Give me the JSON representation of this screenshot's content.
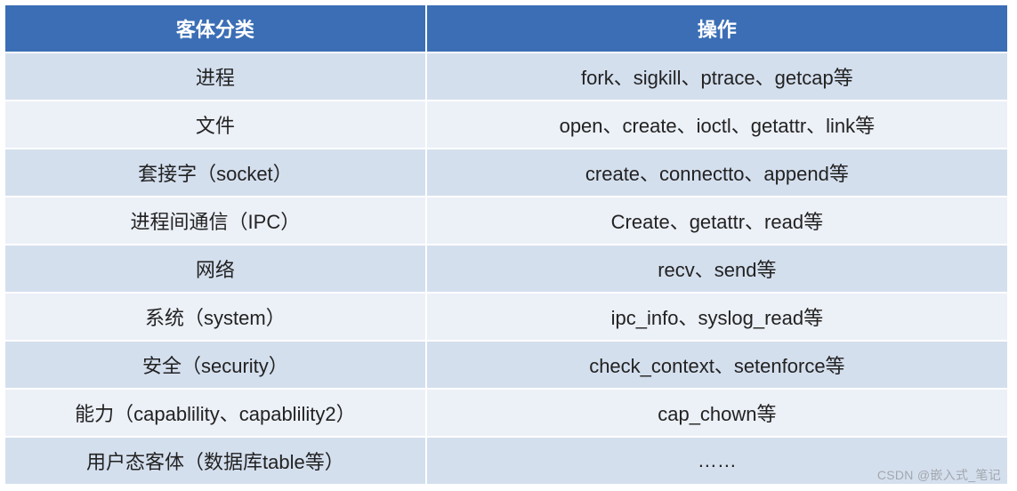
{
  "table": {
    "headers": [
      "客体分类",
      "操作"
    ],
    "rows": [
      {
        "category": "进程",
        "operations": "fork、sigkill、ptrace、getcap等"
      },
      {
        "category": "文件",
        "operations": "open、create、ioctl、getattr、link等"
      },
      {
        "category": "套接字（socket）",
        "operations": "create、connectto、append等"
      },
      {
        "category": "进程间通信（IPC）",
        "operations": "Create、getattr、read等"
      },
      {
        "category": "网络",
        "operations": "recv、send等"
      },
      {
        "category": "系统（system）",
        "operations": "ipc_info、syslog_read等"
      },
      {
        "category": "安全（security）",
        "operations": "check_context、setenforce等"
      },
      {
        "category": "能力（capablility、capablility2）",
        "operations": "cap_chown等"
      },
      {
        "category": "用户态客体（数据库table等）",
        "operations": "……"
      }
    ]
  },
  "watermark": "CSDN @嵌入式_笔记"
}
